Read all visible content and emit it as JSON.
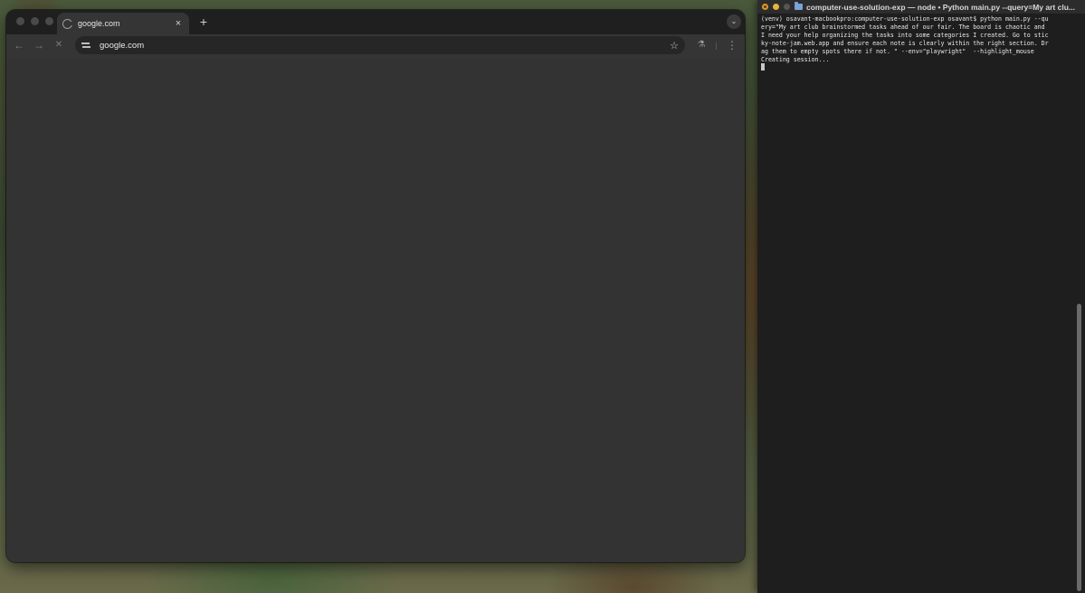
{
  "browser": {
    "tab": {
      "title": "google.com",
      "favicon": "google-g-icon",
      "close": "×"
    },
    "new_tab": "+",
    "tab_search": "⌄",
    "nav": {
      "back": "←",
      "forward": "→",
      "stop": "✕"
    },
    "address_bar": {
      "value": "google.com",
      "site_info_icon": "tune-icon"
    },
    "bookmark_icon": "☆",
    "labs_icon": "⚗",
    "menu_icon": "⋮"
  },
  "terminal": {
    "title": "computer-use-solution-exp — node • Python main.py --query=My art clu...",
    "lines": [
      "(venv) osavant-macbookpro:computer-use-solution-exp osavant$ python main.py --qu",
      "ery=\"My art club brainstormed tasks ahead of our fair. The board is chaotic and",
      "I need your help organizing the tasks into some categories I created. Go to stic",
      "ky-note-jam.web.app and ensure each note is clearly within the right section. Dr",
      "ag them to empty spots there if not. \" --env=\"playwright\"  --highlight_mouse",
      "Creating session..."
    ]
  }
}
